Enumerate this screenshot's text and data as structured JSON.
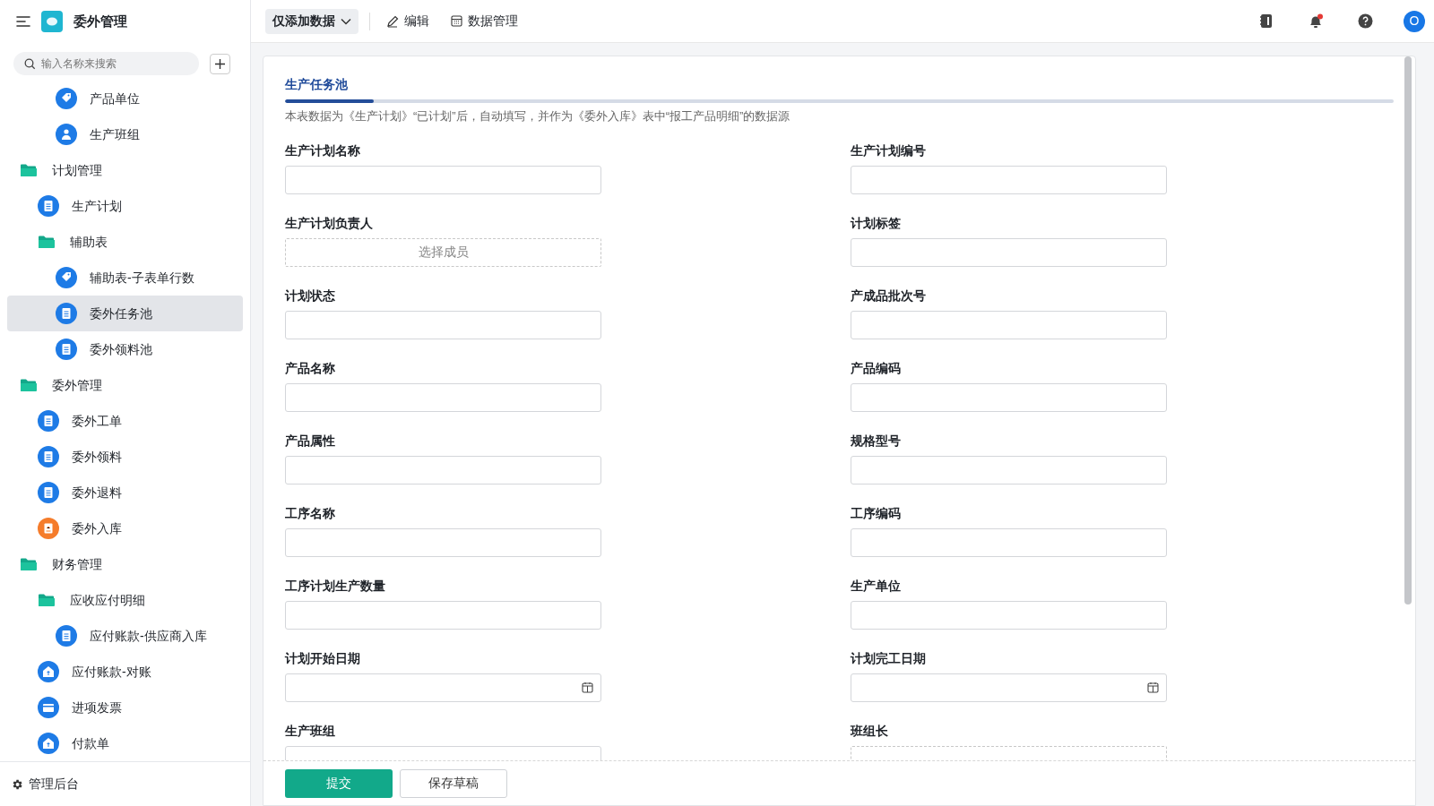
{
  "app": {
    "title": "委外管理"
  },
  "search": {
    "placeholder": "输入名称来搜索"
  },
  "sidebar": {
    "partial_branch": [
      {
        "label": "产品单位",
        "kind": "tag",
        "color": "#1e7be6",
        "selected": false
      },
      {
        "label": "生产班组",
        "kind": "person",
        "color": "#1e7be6",
        "selected": false
      }
    ],
    "items": [
      {
        "label": "计划管理",
        "kind": "folder",
        "selected": false,
        "children": [
          {
            "label": "生产计划",
            "kind": "doc",
            "color": "#1e7be6",
            "selected": false
          },
          {
            "label": "辅助表",
            "kind": "folder",
            "selected": false,
            "children": [
              {
                "label": "辅助表-子表单行数",
                "kind": "tag",
                "color": "#1e7be6",
                "selected": false
              },
              {
                "label": "委外任务池",
                "kind": "doc",
                "color": "#1e7be6",
                "selected": true
              },
              {
                "label": "委外领料池",
                "kind": "doc",
                "color": "#1e7be6",
                "selected": false
              }
            ]
          }
        ]
      },
      {
        "label": "委外管理",
        "kind": "folder",
        "selected": false,
        "children": [
          {
            "label": "委外工单",
            "kind": "doc",
            "color": "#1e7be6",
            "selected": false
          },
          {
            "label": "委外领料",
            "kind": "doc",
            "color": "#1e7be6",
            "selected": false
          },
          {
            "label": "委外退料",
            "kind": "doc",
            "color": "#1e7be6",
            "selected": false
          },
          {
            "label": "委外入库",
            "kind": "clipboard",
            "color": "#f57c2b",
            "selected": false
          }
        ]
      },
      {
        "label": "财务管理",
        "kind": "folder",
        "selected": false,
        "children": [
          {
            "label": "应收应付明细",
            "kind": "folder",
            "selected": false,
            "children": [
              {
                "label": "应付账款-供应商入库",
                "kind": "doc",
                "color": "#1e7be6",
                "selected": false
              }
            ]
          },
          {
            "label": "应付账款-对账",
            "kind": "house",
            "color": "#1e7be6",
            "selected": false
          },
          {
            "label": "进项发票",
            "kind": "card",
            "color": "#1e7be6",
            "selected": false
          },
          {
            "label": "付款单",
            "kind": "house",
            "color": "#1e7be6",
            "selected": false
          }
        ]
      }
    ],
    "footer": "管理后台"
  },
  "toolbar": {
    "mode_button": "仅添加数据",
    "edit": "编辑",
    "data_manage": "数据管理",
    "avatar": "O",
    "has_notification": true
  },
  "form": {
    "title": "生产任务池",
    "level": 0.08,
    "description": "本表数据为《生产计划》“已计划”后，自动填写，并作为《委外入库》表中“报工产品明细”的数据源",
    "fields": [
      {
        "label": "生产计划名称",
        "kind": "text"
      },
      {
        "label": "生产计划编号",
        "kind": "text"
      },
      {
        "label": "生产计划负责人",
        "kind": "member",
        "placeholder": "选择成员"
      },
      {
        "label": "计划标签",
        "kind": "text"
      },
      {
        "label": "计划状态",
        "kind": "text"
      },
      {
        "label": "产成品批次号",
        "kind": "text"
      },
      {
        "label": "产品名称",
        "kind": "text"
      },
      {
        "label": "产品编码",
        "kind": "text"
      },
      {
        "label": "产品属性",
        "kind": "text"
      },
      {
        "label": "规格型号",
        "kind": "text"
      },
      {
        "label": "工序名称",
        "kind": "text"
      },
      {
        "label": "工序编码",
        "kind": "text"
      },
      {
        "label": "工序计划生产数量",
        "kind": "text"
      },
      {
        "label": "生产单位",
        "kind": "text"
      },
      {
        "label": "计划开始日期",
        "kind": "date"
      },
      {
        "label": "计划完工日期",
        "kind": "date"
      },
      {
        "label": "生产班组",
        "kind": "text"
      },
      {
        "label": "班组长",
        "kind": "member"
      }
    ],
    "buttons": [
      {
        "label": "提交",
        "kind": "primary"
      },
      {
        "label": "保存草稿",
        "kind": "secondary"
      }
    ]
  }
}
